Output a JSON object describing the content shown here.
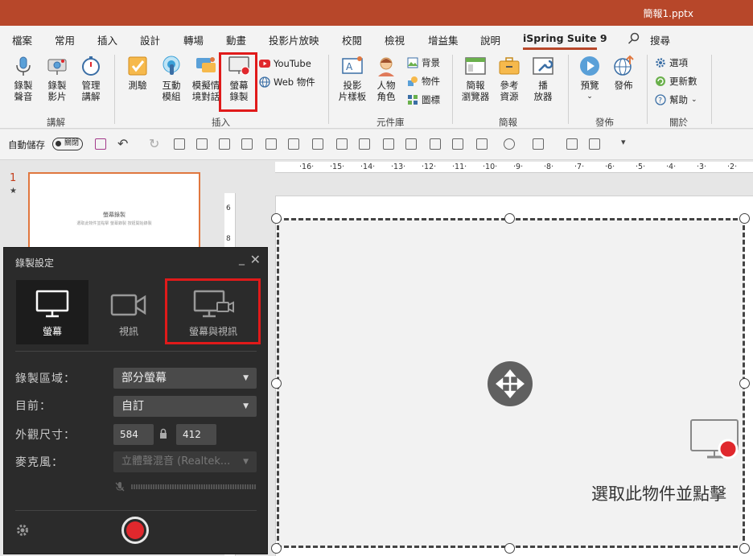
{
  "window": {
    "filename": "簡報1.pptx"
  },
  "tabs": [
    {
      "label": "檔案"
    },
    {
      "label": "常用"
    },
    {
      "label": "插入"
    },
    {
      "label": "設計"
    },
    {
      "label": "轉場"
    },
    {
      "label": "動畫"
    },
    {
      "label": "投影片放映"
    },
    {
      "label": "校閱"
    },
    {
      "label": "檢視"
    },
    {
      "label": "增益集"
    },
    {
      "label": "說明"
    },
    {
      "label": "iSpring Suite 9",
      "active": true
    },
    {
      "label": "搜尋",
      "icon": "search-icon"
    }
  ],
  "ribbon": {
    "narration": {
      "group_label": "講解",
      "record_audio": "錄製\n聲音",
      "record_video": "錄製\n影片",
      "manage_narration": "管理\n講解"
    },
    "insert": {
      "group_label": "插入",
      "quiz": "測驗",
      "interaction": "互動\n模組",
      "dialog_sim": "模擬情\n境對話",
      "screen_record": "螢幕\n錄製",
      "youtube": "YouTube",
      "web_object": "Web 物件"
    },
    "content_library": {
      "group_label": "元件庫",
      "slide_templates": "投影\n片樣板",
      "characters": "人物\n角色",
      "backgrounds": "背景",
      "objects": "物件",
      "icons": "圖標"
    },
    "presentation": {
      "group_label": "簡報",
      "browser": "簡報\n瀏覽器",
      "references": "參考\n資源",
      "player": "播\n放器"
    },
    "publish": {
      "group_label": "發佈",
      "preview": "預覽",
      "publish": "發佈"
    },
    "about": {
      "group_label": "關於",
      "options": "選項",
      "update": "更新數",
      "help": "幫助"
    }
  },
  "qat": {
    "autosave_label": "自動儲存",
    "autosave_state": "關閉"
  },
  "slides_pane": {
    "slide_number": "1",
    "thumb_title": "螢幕錄製",
    "thumb_subtitle": "選取此物件並點擊 螢幕錄製 按鈕開始錄製"
  },
  "rulers": {
    "horizontal": [
      "16",
      "15",
      "14",
      "13",
      "12",
      "11",
      "10",
      "9",
      "8",
      "7",
      "6",
      "5",
      "4",
      "3",
      "2"
    ],
    "vertical": [
      "6",
      "8"
    ]
  },
  "slide": {
    "hint_text": "選取此物件並點擊"
  },
  "record_dialog": {
    "title": "錄製設定",
    "modes": [
      {
        "label": "螢幕",
        "selected": true
      },
      {
        "label": "視訊",
        "selected": false
      },
      {
        "label": "螢幕與視訊",
        "selected": false,
        "highlighted": true
      }
    ],
    "area_label": "錄製區域：",
    "area_value": "部分螢幕",
    "current_label": "目前：",
    "current_value": "自訂",
    "size_label": "外觀尺寸：",
    "width": "584",
    "height": "412",
    "mic_label": "麥克風：",
    "mic_value": "立體聲混音 (Realtek..."
  },
  "colors": {
    "accent": "#b7472a",
    "highlight": "#e01a1a",
    "record": "#e0282d"
  }
}
